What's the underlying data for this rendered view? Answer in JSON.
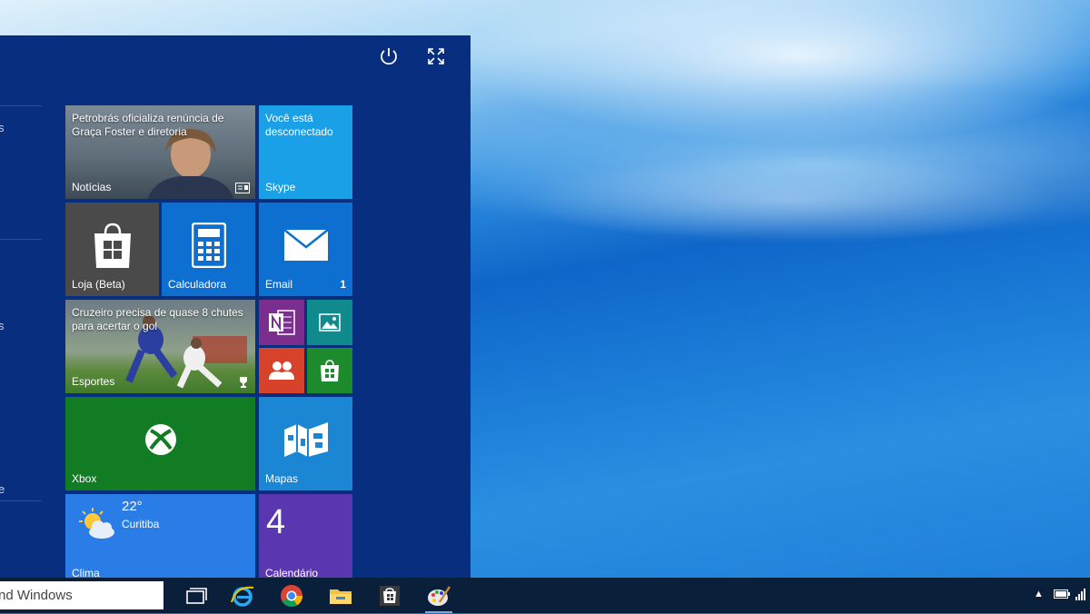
{
  "start_menu": {
    "left_fragments": [
      "s",
      "s",
      "e"
    ],
    "tiles": {
      "news": {
        "headline": "Petrobrás oficializa renúncia de Graça Foster e diretoria",
        "label": "Notícias"
      },
      "skype": {
        "headline": "Você está desconectado",
        "label": "Skype"
      },
      "store": {
        "label": "Loja (Beta)"
      },
      "calculator": {
        "label": "Calculadora"
      },
      "email": {
        "label": "Email",
        "badge": "1"
      },
      "sports": {
        "headline": "Cruzeiro precisa de quase 8 chutes para acertar o gol",
        "label": "Esportes"
      },
      "xbox": {
        "label": "Xbox"
      },
      "maps": {
        "label": "Mapas"
      },
      "weather": {
        "temperature": "22°",
        "city": "Curitiba",
        "label": "Clima"
      },
      "calendar": {
        "day": "4",
        "label": "Calendário"
      }
    }
  },
  "taskbar": {
    "search_text": "nd Windows"
  },
  "colors": {
    "start_bg": "#082e7f",
    "tile_blue": "#0d6fcf",
    "tile_lightblue": "#1aa0e6",
    "tile_green": "#127c25",
    "tile_purple": "#5a36b0",
    "tile_gray": "#4a4a4a",
    "onenote": "#7a2e8e",
    "photos": "#118a8d",
    "people": "#d6422a",
    "store_small": "#1e8a2e",
    "taskbar": "#0a1f3a"
  }
}
